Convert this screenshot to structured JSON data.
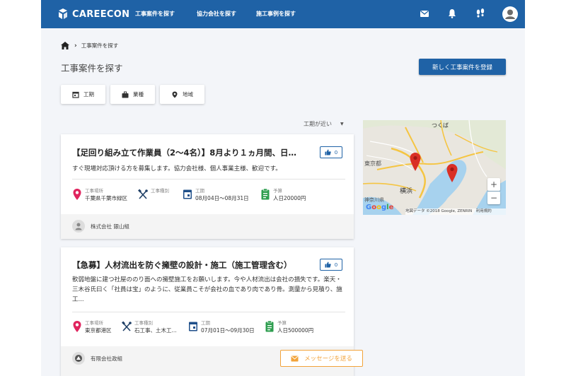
{
  "header": {
    "logo_text": "CAREECON",
    "nav": [
      "工事案件を探す",
      "協力会社を探す",
      "施工事例を探す"
    ],
    "icons": [
      "mail-icon",
      "bell-icon",
      "footprints-icon",
      "user-avatar"
    ],
    "brand_color": "#1f62a6"
  },
  "breadcrumb": {
    "current": "工事案件を探す"
  },
  "page_title": "工事案件を探す",
  "register_button": "新しく工事案件を登録",
  "filters": [
    {
      "label": "工期",
      "icon": "calendar-icon"
    },
    {
      "label": "業種",
      "icon": "briefcase-icon"
    },
    {
      "label": "地域",
      "icon": "map-pin-icon"
    }
  ],
  "sort": {
    "label": "工期が近い"
  },
  "jobs": [
    {
      "title": "【足回り組み立て作業員（2〜4名）】8月より１ヵ月間、日…",
      "likes": "0",
      "description": "すぐ現場対応頂ける方を募集します。協力会社様、個人事業主様、歓迎です。",
      "location_label": "工事場所",
      "location": "千葉県千葉市緑区",
      "type_label": "工事種別",
      "type": "",
      "period_label": "工期",
      "period": "08月04日〜08月31日",
      "budget_label": "予算",
      "budget": "人日20000円",
      "company": "株式会社 銀山組"
    },
    {
      "title": "【急募】人材流出を防ぐ擁壁の設計・施工（施工管理含む）",
      "likes": "0",
      "description": "軟弱地盤に建つ社屋ののり面への擁壁施工をお願いします。今や人材流出は会社の損失です。楽天・三木谷氏曰く「社員は宝」のように、従業員こそが会社の血であり肉であり骨。測量から見積り、施工...",
      "location_label": "工事場所",
      "location": "東京都港区",
      "type_label": "工事種別",
      "type": "石工事、土木工...",
      "period_label": "工期",
      "period": "07月01日〜09月30日",
      "budget_label": "予算",
      "budget": "人日500000円",
      "company": "有限会社政組",
      "message_button": "メッセージを送る"
    }
  ],
  "map": {
    "labels": {
      "tsukuba": "つくば",
      "tokyo": "東京都",
      "kanagawa": "神奈川県",
      "yokohama": "横浜"
    },
    "zoom_in": "+",
    "zoom_out": "−",
    "google": "Google",
    "attribution": "地図データ ©2018 Google, ZENRIN　利用規約",
    "pin_color": "#d93025"
  }
}
